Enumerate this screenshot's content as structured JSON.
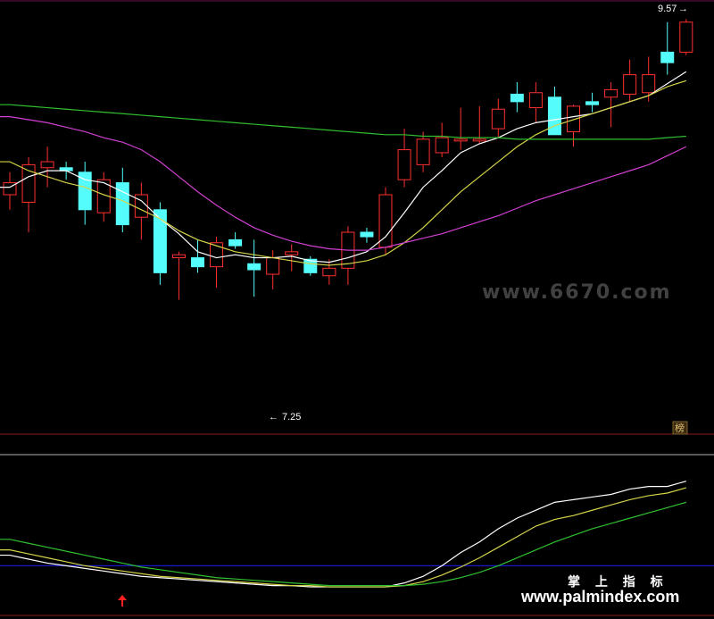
{
  "chart_data": {
    "type": "candlestick",
    "ylim": [
      6.9,
      9.65
    ],
    "max_label": "9.57",
    "min_label": "7.25",
    "candles": [
      {
        "o": 8.4,
        "h": 8.55,
        "l": 8.3,
        "c": 8.48,
        "color": "red"
      },
      {
        "o": 8.35,
        "h": 8.65,
        "l": 8.15,
        "c": 8.6,
        "color": "red"
      },
      {
        "o": 8.58,
        "h": 8.72,
        "l": 8.45,
        "c": 8.62,
        "color": "red"
      },
      {
        "o": 8.58,
        "h": 8.62,
        "l": 8.5,
        "c": 8.56,
        "color": "cyan"
      },
      {
        "o": 8.55,
        "h": 8.62,
        "l": 8.2,
        "c": 8.3,
        "color": "cyan"
      },
      {
        "o": 8.28,
        "h": 8.55,
        "l": 8.22,
        "c": 8.5,
        "color": "red"
      },
      {
        "o": 8.48,
        "h": 8.58,
        "l": 8.15,
        "c": 8.2,
        "color": "cyan"
      },
      {
        "o": 8.25,
        "h": 8.48,
        "l": 8.1,
        "c": 8.4,
        "color": "red"
      },
      {
        "o": 8.3,
        "h": 8.35,
        "l": 7.8,
        "c": 7.88,
        "color": "cyan"
      },
      {
        "o": 7.98,
        "h": 8.02,
        "l": 7.7,
        "c": 8.0,
        "color": "red"
      },
      {
        "o": 7.98,
        "h": 8.1,
        "l": 7.88,
        "c": 7.92,
        "color": "cyan"
      },
      {
        "o": 7.92,
        "h": 8.12,
        "l": 7.78,
        "c": 8.08,
        "color": "red"
      },
      {
        "o": 8.1,
        "h": 8.15,
        "l": 8.04,
        "c": 8.06,
        "color": "cyan"
      },
      {
        "o": 7.94,
        "h": 8.1,
        "l": 7.72,
        "c": 7.9,
        "color": "cyan"
      },
      {
        "o": 7.87,
        "h": 8.03,
        "l": 7.77,
        "c": 7.98,
        "color": "red"
      },
      {
        "o": 8.0,
        "h": 8.07,
        "l": 7.89,
        "c": 8.02,
        "color": "red"
      },
      {
        "o": 7.97,
        "h": 7.99,
        "l": 7.86,
        "c": 7.88,
        "color": "cyan"
      },
      {
        "o": 7.86,
        "h": 7.97,
        "l": 7.8,
        "c": 7.91,
        "color": "red"
      },
      {
        "o": 7.91,
        "h": 8.19,
        "l": 7.8,
        "c": 8.15,
        "color": "red"
      },
      {
        "o": 8.15,
        "h": 8.18,
        "l": 8.08,
        "c": 8.12,
        "color": "cyan"
      },
      {
        "o": 8.05,
        "h": 8.45,
        "l": 8.0,
        "c": 8.4,
        "color": "red"
      },
      {
        "o": 8.5,
        "h": 8.84,
        "l": 8.45,
        "c": 8.7,
        "color": "red"
      },
      {
        "o": 8.6,
        "h": 8.82,
        "l": 8.55,
        "c": 8.77,
        "color": "red"
      },
      {
        "o": 8.68,
        "h": 8.88,
        "l": 8.65,
        "c": 8.78,
        "color": "red"
      },
      {
        "o": 8.77,
        "h": 8.98,
        "l": 8.7,
        "c": 8.77,
        "color": "red"
      },
      {
        "o": 8.76,
        "h": 8.99,
        "l": 8.74,
        "c": 8.77,
        "color": "red"
      },
      {
        "o": 8.84,
        "h": 9.04,
        "l": 8.78,
        "c": 8.97,
        "color": "red"
      },
      {
        "o": 9.02,
        "h": 9.15,
        "l": 8.95,
        "c": 9.07,
        "color": "cyan"
      },
      {
        "o": 8.98,
        "h": 9.15,
        "l": 8.88,
        "c": 9.08,
        "color": "red"
      },
      {
        "o": 9.05,
        "h": 9.12,
        "l": 8.82,
        "c": 8.8,
        "color": "cyan"
      },
      {
        "o": 8.82,
        "h": 9.0,
        "l": 8.72,
        "c": 8.99,
        "color": "red"
      },
      {
        "o": 9.0,
        "h": 9.08,
        "l": 8.95,
        "c": 9.02,
        "color": "cyan"
      },
      {
        "o": 9.05,
        "h": 9.15,
        "l": 8.85,
        "c": 9.1,
        "color": "red"
      },
      {
        "o": 9.07,
        "h": 9.3,
        "l": 9.02,
        "c": 9.2,
        "color": "red"
      },
      {
        "o": 9.08,
        "h": 9.32,
        "l": 9.02,
        "c": 9.2,
        "color": "red"
      },
      {
        "o": 9.35,
        "h": 9.55,
        "l": 9.2,
        "c": 9.28,
        "color": "cyan"
      },
      {
        "o": 9.35,
        "h": 9.57,
        "l": 9.33,
        "c": 9.55,
        "color": "red"
      }
    ],
    "ma": [
      {
        "color": "#ffffff",
        "values": [
          8.45,
          8.52,
          8.56,
          8.56,
          8.5,
          8.48,
          8.42,
          8.36,
          8.24,
          8.14,
          8.02,
          7.98,
          8.0,
          7.98,
          7.98,
          7.99,
          7.96,
          7.95,
          7.98,
          8.02,
          8.12,
          8.28,
          8.45,
          8.56,
          8.68,
          8.74,
          8.78,
          8.84,
          8.88,
          8.9,
          8.92,
          8.94,
          8.98,
          9.02,
          9.06,
          9.14,
          9.22
        ]
      },
      {
        "color": "#d4d44a",
        "values": [
          8.62,
          8.56,
          8.52,
          8.48,
          8.45,
          8.4,
          8.36,
          8.3,
          8.24,
          8.16,
          8.1,
          8.06,
          8.02,
          8.0,
          7.98,
          7.96,
          7.94,
          7.93,
          7.94,
          7.96,
          8.0,
          8.08,
          8.18,
          8.3,
          8.42,
          8.52,
          8.62,
          8.72,
          8.8,
          8.86,
          8.9,
          8.94,
          8.98,
          9.02,
          9.06,
          9.12,
          9.16
        ]
      },
      {
        "color": "#d040d0",
        "values": [
          8.92,
          8.9,
          8.88,
          8.85,
          8.82,
          8.78,
          8.75,
          8.7,
          8.62,
          8.52,
          8.42,
          8.33,
          8.25,
          8.18,
          8.13,
          8.09,
          8.06,
          8.04,
          8.03,
          8.03,
          8.05,
          8.08,
          8.11,
          8.14,
          8.18,
          8.22,
          8.26,
          8.31,
          8.36,
          8.4,
          8.44,
          8.48,
          8.52,
          8.56,
          8.6,
          8.66,
          8.72
        ]
      },
      {
        "color": "#30c030",
        "values": [
          9.0,
          8.99,
          8.98,
          8.97,
          8.96,
          8.95,
          8.94,
          8.93,
          8.92,
          8.91,
          8.9,
          8.89,
          8.88,
          8.87,
          8.86,
          8.85,
          8.84,
          8.83,
          8.82,
          8.81,
          8.8,
          8.8,
          8.79,
          8.79,
          8.78,
          8.78,
          8.78,
          8.77,
          8.77,
          8.77,
          8.77,
          8.77,
          8.77,
          8.77,
          8.77,
          8.78,
          8.79
        ]
      }
    ],
    "indicator": {
      "ylim": [
        0,
        100
      ],
      "ref_line": 20,
      "series": [
        {
          "color": "#ffffff",
          "values": [
            28,
            25,
            22,
            20,
            18,
            16,
            14,
            12,
            11,
            10,
            9,
            8,
            7,
            6,
            5,
            5,
            4,
            4,
            4,
            4,
            4,
            7,
            12,
            20,
            30,
            38,
            48,
            56,
            62,
            68,
            70,
            72,
            74,
            78,
            80,
            80,
            84
          ]
        },
        {
          "color": "#d4d44a",
          "values": [
            32,
            29,
            26,
            23,
            20,
            18,
            16,
            14,
            12,
            11,
            10,
            9,
            8,
            7,
            6,
            5,
            5,
            4,
            4,
            4,
            4,
            5,
            8,
            13,
            19,
            26,
            34,
            42,
            50,
            55,
            58,
            62,
            66,
            70,
            73,
            75,
            79
          ]
        },
        {
          "color": "#30c030",
          "values": [
            40,
            37,
            34,
            31,
            28,
            25,
            22,
            19,
            17,
            15,
            13,
            11,
            10,
            9,
            8,
            7,
            6,
            5,
            5,
            5,
            5,
            5,
            6,
            8,
            11,
            15,
            20,
            26,
            32,
            38,
            43,
            48,
            52,
            56,
            60,
            64,
            68
          ]
        }
      ]
    }
  },
  "watermarks": {
    "site_small": "www.6670.com",
    "cn_text": "掌 上 指 标",
    "site_main": "www.palmindex.com",
    "badge": "榜"
  }
}
